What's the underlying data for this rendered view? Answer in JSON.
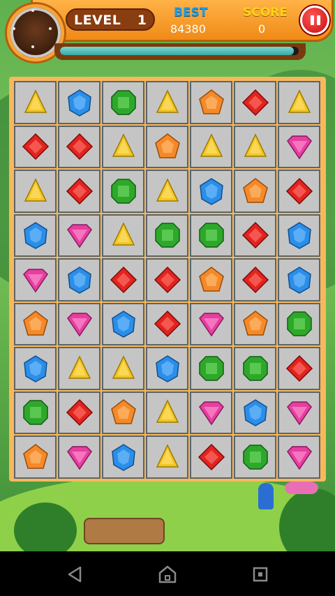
{
  "hud": {
    "level_label": "LEVEL",
    "level_value": "1",
    "best_label": "BEST",
    "best_value": "84380",
    "score_label": "SCORE",
    "score_value": "0",
    "progress": 0.98,
    "pause_icon": "pause-icon"
  },
  "colors": {
    "yellow": "#f2c623",
    "blue": "#2b8ee8",
    "green": "#2ea82a",
    "orange": "#f5892a",
    "red": "#e2231e",
    "pink": "#e63fa0"
  },
  "board": {
    "rows": [
      [
        "yellow",
        "blue",
        "green",
        "yellow",
        "orange",
        "red",
        "yellow"
      ],
      [
        "red",
        "red",
        "yellow",
        "orange",
        "yellow",
        "yellow",
        "pink"
      ],
      [
        "yellow",
        "red",
        "green",
        "yellow",
        "blue",
        "orange",
        "red"
      ],
      [
        "blue",
        "pink",
        "yellow",
        "green",
        "green",
        "red",
        "blue"
      ],
      [
        "pink",
        "blue",
        "red",
        "red",
        "orange",
        "red",
        "blue"
      ],
      [
        "orange",
        "pink",
        "blue",
        "red",
        "pink",
        "orange",
        "green"
      ],
      [
        "blue",
        "yellow",
        "yellow",
        "blue",
        "green",
        "green",
        "red"
      ],
      [
        "green",
        "red",
        "orange",
        "yellow",
        "pink",
        "blue",
        "pink"
      ],
      [
        "orange",
        "pink",
        "blue",
        "yellow",
        "red",
        "green",
        "pink"
      ]
    ]
  },
  "nav": {
    "items": [
      "back-icon",
      "home-icon",
      "recent-apps-icon"
    ]
  }
}
